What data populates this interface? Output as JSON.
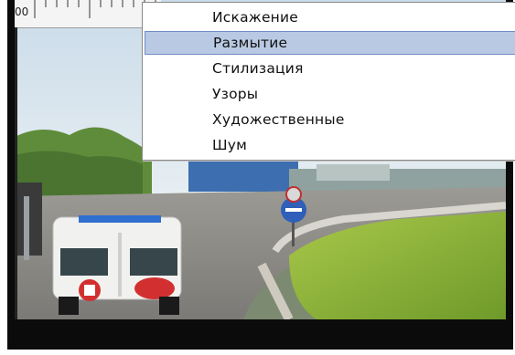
{
  "ruler": {
    "label": "00"
  },
  "menu": {
    "items": [
      {
        "label": "Искажение",
        "highlighted": false
      },
      {
        "label": "Размытие",
        "highlighted": true
      },
      {
        "label": "Стилизация",
        "highlighted": false
      },
      {
        "label": "Узоры",
        "highlighted": false
      },
      {
        "label": "Художественные",
        "highlighted": false
      },
      {
        "label": "Шум",
        "highlighted": false
      }
    ]
  },
  "colors": {
    "highlight": "#b9c9e3",
    "highlight_border": "#6f8ec3",
    "frame": "#0b0b0b"
  }
}
